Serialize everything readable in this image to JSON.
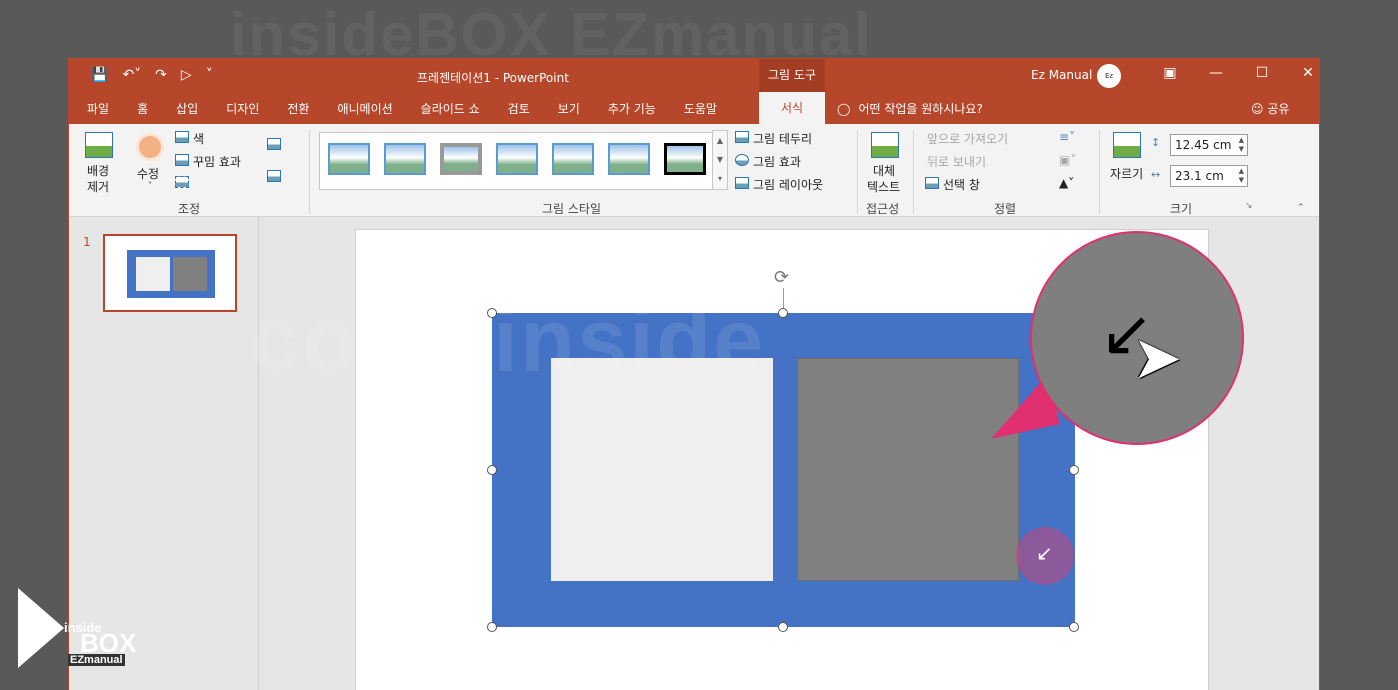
{
  "watermarks": {
    "top": "insideBOX EZmanual",
    "mid": "comeinside",
    "bottom": "insideBOX EZmanual"
  },
  "titlebar": {
    "qat_icons": [
      "save-icon",
      "undo-icon",
      "redo-icon",
      "start-from-beginning-icon",
      "customize-qat-icon"
    ],
    "document_title": "프레젠테이션1  -  PowerPoint",
    "contextual_tab_group": "그림 도구",
    "user_name": "Ez Manual",
    "avatar_text": "Ez Manual",
    "window_controls": [
      "ribbon-display-icon",
      "minimize-icon",
      "maximize-icon",
      "close-icon"
    ]
  },
  "ribbon_tabs": {
    "items": [
      "파일",
      "홈",
      "삽입",
      "디자인",
      "전환",
      "애니메이션",
      "슬라이드 쇼",
      "검토",
      "보기",
      "추가 기능",
      "도움말"
    ],
    "active": "서식",
    "tell_me": "어떤 작업을 원하시나요?",
    "share": "공유"
  },
  "ribbon": {
    "adjust": {
      "remove_bg_line1": "배경",
      "remove_bg_line2": "제거",
      "corrections": "수정",
      "color": "색",
      "artistic_effects": "꾸밈 효과",
      "label": "조정"
    },
    "picture_styles": {
      "border": "그림 테두리",
      "effects": "그림 효과",
      "layout": "그림 레이아웃",
      "label": "그림 스타일"
    },
    "accessibility": {
      "alt_text_line1": "대체",
      "alt_text_line2": "텍스트",
      "label": "접근성"
    },
    "arrange": {
      "bring_forward": "앞으로 가져오기",
      "send_backward": "뒤로 보내기",
      "selection_pane": "선택 창",
      "label": "정렬"
    },
    "size": {
      "crop": "자르기",
      "height": "12.45 cm",
      "width": "23.1 cm",
      "label": "크기"
    }
  },
  "slides_pane": {
    "slide_number": "1"
  },
  "colors": {
    "accent": "#b7472a",
    "picture_blue": "#4472c4",
    "highlight": "#e0306f"
  }
}
